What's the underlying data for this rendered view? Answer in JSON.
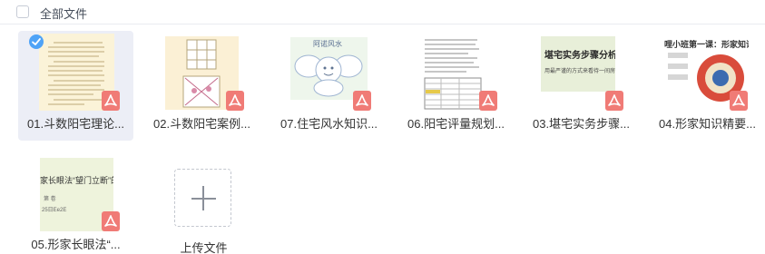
{
  "header": {
    "select_all_label": "全部文件"
  },
  "files": [
    {
      "name": "01.斗数阳宅理论...",
      "type": "pdf",
      "selected": true
    },
    {
      "name": "02.斗数阳宅案例...",
      "type": "pdf",
      "selected": false
    },
    {
      "name": "07.住宅风水知识...",
      "type": "pdf",
      "selected": false
    },
    {
      "name": "06.阳宅评量规划...",
      "type": "pdf",
      "selected": false
    },
    {
      "name": "03.堪宅实务步骤...",
      "type": "pdf",
      "selected": false
    },
    {
      "name": "04.形家知识精要...",
      "type": "pdf",
      "selected": false
    },
    {
      "name": "05.形家长眼法“...",
      "type": "pdf",
      "selected": false
    }
  ],
  "thumb_text": {
    "file3_title": "阿诺风水",
    "file5_title": "堪宅实务步骤分析",
    "file5_subtitle": "用最严谨的方式来看待一间房",
    "file6_title": "哩小班第一课：形家知识",
    "file7_title": "家长眼法“望门立断”的",
    "file7_line2": "第 卷",
    "file7_line3": "25日Ee2E"
  },
  "upload": {
    "label": "上传文件"
  },
  "colors": {
    "selected_bg": "#eceef6",
    "check": "#4fa3f7",
    "pdf_badge": "#f07b76"
  },
  "icons": {
    "pdf": "pdf-file-icon",
    "check": "check-icon",
    "upload": "plus-icon"
  }
}
